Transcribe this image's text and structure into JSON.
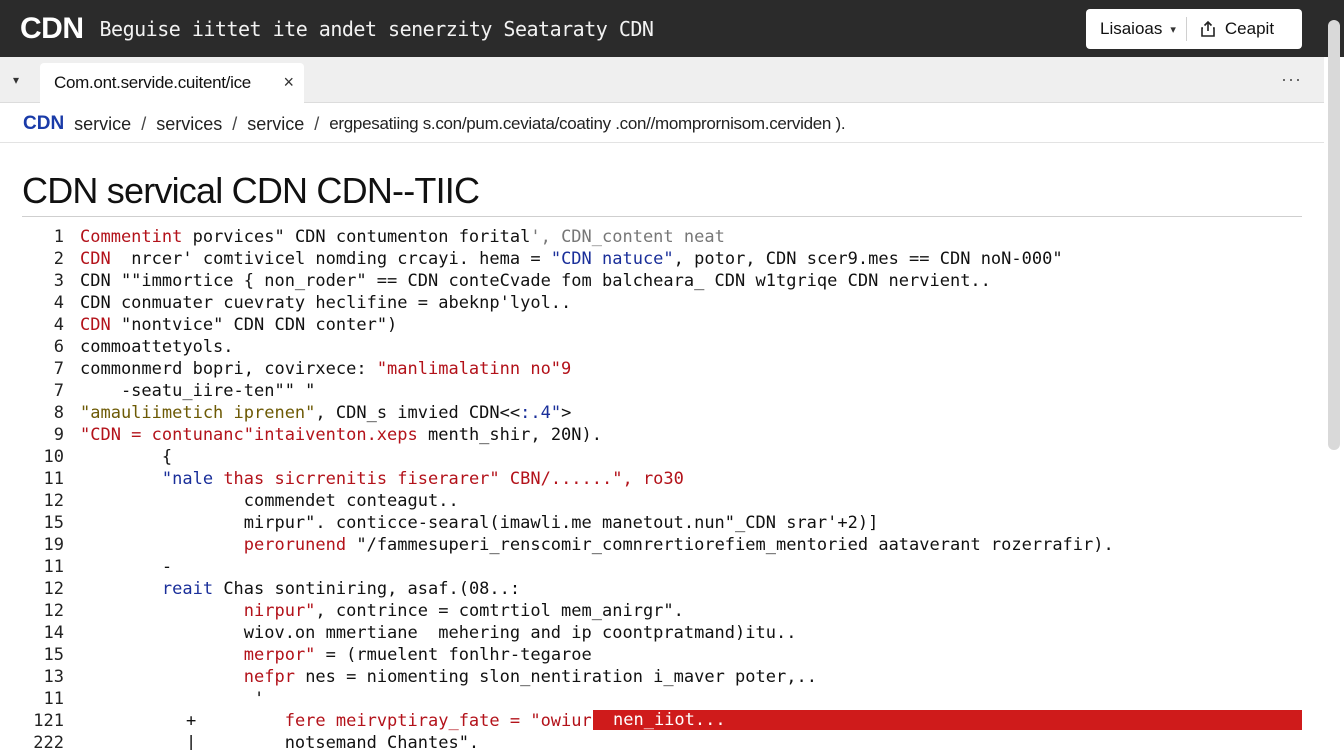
{
  "topbar": {
    "logo": "CDN",
    "title": "Beguise iittet ite andet senerzity Seataraty CDN",
    "select_label": "Lisaioas",
    "export_label": "Ceapit"
  },
  "tabs": {
    "active_label": "Com.ont.servide.cuitent/ice",
    "close_glyph": "×",
    "more_glyph": "···"
  },
  "breadcrumb": {
    "root": "CDN",
    "items": [
      "service",
      "services",
      "service"
    ],
    "url": "ergpesatiing s.con/pum.ceviata/coatiny .con//momprornisom.cerviden  )."
  },
  "page_title": "CDN servical CDN CDN--TIIC",
  "code_lines": [
    {
      "n": "1",
      "segs": [
        {
          "t": "Commentint",
          "c": "red"
        },
        {
          "t": " porvices\" CDN contumenton forital",
          "c": "black"
        },
        {
          "t": "', CDN_content neat",
          "c": "gray"
        }
      ]
    },
    {
      "n": "2",
      "segs": [
        {
          "t": "CDN",
          "c": "red"
        },
        {
          "t": "  nrcer' comtivicel nomding crcayi. hema = ",
          "c": "black"
        },
        {
          "t": "\"CDN natuce\"",
          "c": "blue"
        },
        {
          "t": ", potor, CDN scer9.mes == CDN noN-000\"",
          "c": "black"
        }
      ]
    },
    {
      "n": "3",
      "segs": [
        {
          "t": "CDN \"\"immortice { non_roder\" == CDN conteCvade fom balcheara_ CDN w1tgriqe CDN nervient..",
          "c": "black"
        }
      ]
    },
    {
      "n": "4",
      "segs": [
        {
          "t": "CDN conmuater cuevraty heclifine = abeknp'lyol..",
          "c": "black"
        }
      ]
    },
    {
      "n": "4",
      "segs": [
        {
          "t": "CDN",
          "c": "red"
        },
        {
          "t": " \"nontvice\" CDN CDN conter\")",
          "c": "black"
        }
      ]
    },
    {
      "n": "6",
      "segs": [
        {
          "t": "commoattetyols.",
          "c": "black"
        }
      ]
    },
    {
      "n": "7",
      "segs": [
        {
          "t": "commonmerd bopri, covirxece: ",
          "c": "black"
        },
        {
          "t": "\"manlimalatinn no\"9",
          "c": "red"
        }
      ]
    },
    {
      "n": "7",
      "segs": [
        {
          "t": "    -seatu_iire-ten\"\" \"",
          "c": "black"
        }
      ]
    },
    {
      "n": "8",
      "segs": [
        {
          "t": "\"amauliimetich iprenen\"",
          "c": "olive"
        },
        {
          "t": ", CDN_s imvied CDN<<",
          "c": "black"
        },
        {
          "t": ":.4\"",
          "c": "blue"
        },
        {
          "t": ">",
          "c": "black"
        }
      ]
    },
    {
      "n": "9",
      "segs": [
        {
          "t": "\"CDN = contunanc\"intaiventon.xeps",
          "c": "red"
        },
        {
          "t": " menth_shir, 20N).",
          "c": "black"
        }
      ]
    },
    {
      "n": "10",
      "segs": [
        {
          "t": "        {",
          "c": "black"
        }
      ]
    },
    {
      "n": "11",
      "segs": [
        {
          "t": "        ",
          "c": "black"
        },
        {
          "t": "\"nale",
          "c": "blue"
        },
        {
          "t": " thas sicrrenitis fiserarer\" CBN/......\", ro30",
          "c": "red"
        }
      ]
    },
    {
      "n": "12",
      "segs": [
        {
          "t": "                commendet conteagut..",
          "c": "black"
        }
      ]
    },
    {
      "n": "15",
      "segs": [
        {
          "t": "                mirpur\". conticce-searal(imawli.me manetout.nun\"_CDN srar'+2)]",
          "c": "black"
        }
      ]
    },
    {
      "n": "19",
      "segs": [
        {
          "t": "                perorunend ",
          "c": "red"
        },
        {
          "t": "\"/fammesuperi_renscomir_comnrertiorefiem_mentoried ",
          "c": "black"
        },
        {
          "t": "aataverant rozerrafir).",
          "c": "black"
        }
      ]
    },
    {
      "n": "11",
      "segs": [
        {
          "t": "        -",
          "c": "black"
        }
      ]
    },
    {
      "n": "12",
      "segs": [
        {
          "t": "        ",
          "c": "black"
        },
        {
          "t": "reait",
          "c": "blue"
        },
        {
          "t": " Chas sontiniring, asaf.(08..:",
          "c": "black"
        }
      ]
    },
    {
      "n": "12",
      "segs": [
        {
          "t": "                ",
          "c": "black"
        },
        {
          "t": "nirpur\"",
          "c": "red"
        },
        {
          "t": ", contrince = comtrtiol mem_anirgr\".",
          "c": "black"
        }
      ]
    },
    {
      "n": "14",
      "segs": [
        {
          "t": "                wiov.on mmertiane  mehering and ip coontpratmand)itu..",
          "c": "black"
        }
      ]
    },
    {
      "n": "15",
      "segs": [
        {
          "t": "                ",
          "c": "black"
        },
        {
          "t": "merpor\"",
          "c": "red"
        },
        {
          "t": " = (rmuelent fonlhr-tegaroe",
          "c": "black"
        }
      ]
    },
    {
      "n": "13",
      "segs": [
        {
          "t": "                ",
          "c": "black"
        },
        {
          "t": "nefpr",
          "c": "red"
        },
        {
          "t": " nes = niomenting slon_nentiration i_maver poter,..",
          "c": "black"
        }
      ]
    },
    {
      "n": "11",
      "segs": [
        {
          "t": "                 '",
          "c": "black"
        }
      ]
    },
    {
      "n": "121",
      "mark": "+",
      "segs": [
        {
          "t": "                    ",
          "c": "black"
        },
        {
          "t": "fere meirvptiray_fate = \"owiur",
          "c": "red"
        }
      ],
      "highlight": "nen_iiot..."
    },
    {
      "n": "222",
      "mark": "|",
      "segs": [
        {
          "t": "                    notsemand Chantes\".",
          "c": "black"
        }
      ]
    }
  ]
}
